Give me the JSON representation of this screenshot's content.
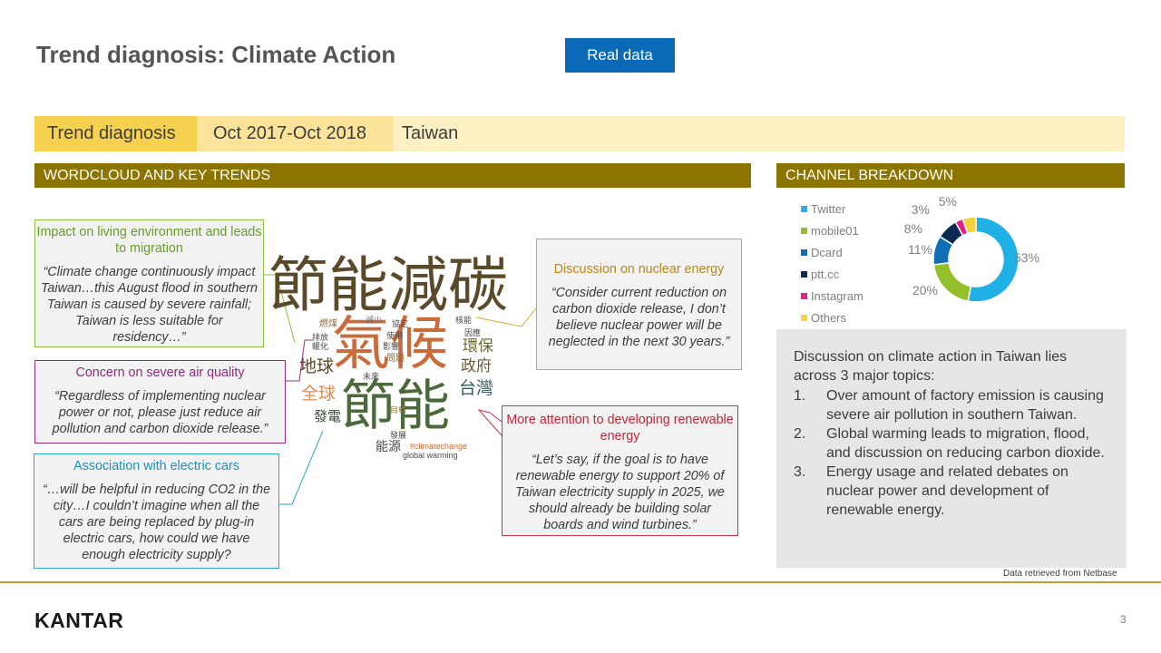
{
  "header": {
    "title": "Trend diagnosis: Climate Action",
    "badge": "Real data"
  },
  "trend_bar": {
    "label": "Trend diagnosis",
    "period": "Oct 2017-Oct 2018",
    "region": "Taiwan"
  },
  "sections": {
    "wordcloud": "WORDCLOUD AND KEY TRENDS",
    "channel": "CHANNEL BREAKDOWN"
  },
  "callouts": {
    "living": {
      "title": "Impact on living environment and leads to migration",
      "quote": "“Climate change continuously impact Taiwan…this August flood in southern Taiwan is caused by severe rainfall; Taiwan is less suitable for residency…”"
    },
    "air": {
      "title": "Concern on severe air quality",
      "quote": "“Regardless of implementing nuclear power or not, please just reduce air pollution and carbon dioxide release.”"
    },
    "cars": {
      "title": "Association with electric cars",
      "quote": "“…will be helpful in reducing CO2 in the city…I couldn’t imagine when all the cars are being replaced by plug-in electric cars, how could we have enough electricity supply?"
    },
    "nuclear": {
      "title": "Discussion on nuclear energy",
      "quote": "“Consider current reduction on carbon dioxide release, I don’t believe nuclear power will be neglected in the next 30 years.”"
    },
    "renewable": {
      "title": "More attention to developing renewable energy",
      "quote": "“Let’s say, if the goal is to have renewable energy to support 20% of Taiwan electricity supply in 2025, we should already be building solar boards and wind turbines.”"
    }
  },
  "wordcloud": {
    "w1": "節能減碳",
    "w2": "氣候",
    "w3": "節能",
    "w4": "地球",
    "w5": "全球",
    "w6": "環保",
    "w7": "政府",
    "w8": "台灣",
    "w9": "發電",
    "w10": "能源",
    "w11": "燃煤",
    "w12": "減少",
    "w13": "協定",
    "w14": "排放",
    "w15": "暖化",
    "w16": "使用",
    "w17": "影響",
    "w18": "問題",
    "w19": "核能",
    "w20": "因應",
    "w21": "未來",
    "w22": "目標",
    "w23": "#climatechange",
    "w24": "發展",
    "w25": "global warming"
  },
  "chart_data": {
    "type": "pie",
    "subtype": "donut",
    "categories": [
      "Twitter",
      "mobile01",
      "Dcard",
      "ptt.cc",
      "Instagram",
      "Others"
    ],
    "values": [
      53,
      20,
      11,
      8,
      3,
      5
    ],
    "value_labels": [
      "53%",
      "20%",
      "11%",
      "8%",
      "3%",
      "5%"
    ],
    "colors": [
      "#1fb0e6",
      "#93bf2a",
      "#0e6fb5",
      "#0c2a52",
      "#e61e8c",
      "#f7d23a"
    ],
    "legend_position": "left"
  },
  "summary": {
    "intro": "Discussion on climate action in Taiwan lies across 3 major topics:",
    "items": [
      {
        "n": "1.",
        "text": "Over amount of factory emission is causing severe air pollution in southern Taiwan."
      },
      {
        "n": "2.",
        "text": "Global warming leads to migration, flood, and discussion on reducing carbon dioxide."
      },
      {
        "n": "3.",
        "text": "Energy usage and related debates on nuclear power and development of renewable energy."
      }
    ]
  },
  "footer": {
    "source": "Data retrieved from Netbase",
    "logo": "KANTAR",
    "page": "3"
  }
}
